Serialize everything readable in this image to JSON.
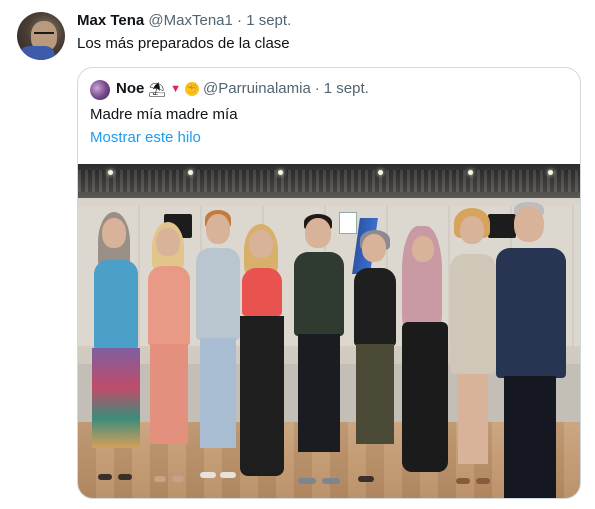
{
  "tweet": {
    "author_name": "Max Tena",
    "author_handle": "@MaxTena1",
    "separator": "·",
    "date": "1 sept.",
    "text": "Los más preparados de la clase",
    "avatar_icon": "user-avatar"
  },
  "quoted": {
    "author_name": "Noe",
    "emoji_icons": [
      "beach-umbrella-emoji",
      "red-triangle-emoji",
      "raised-fist-emoji"
    ],
    "author_handle": "@Parruinalamia",
    "separator": "·",
    "date": "1 sept.",
    "text": "Madre mía madre mía",
    "thread_link": "Mostrar este hilo",
    "photo_icon": "group-photo-image"
  },
  "colors": {
    "link": "#1d9bf0",
    "muted": "#536471",
    "border": "#cfd9de",
    "text": "#0f1419"
  }
}
